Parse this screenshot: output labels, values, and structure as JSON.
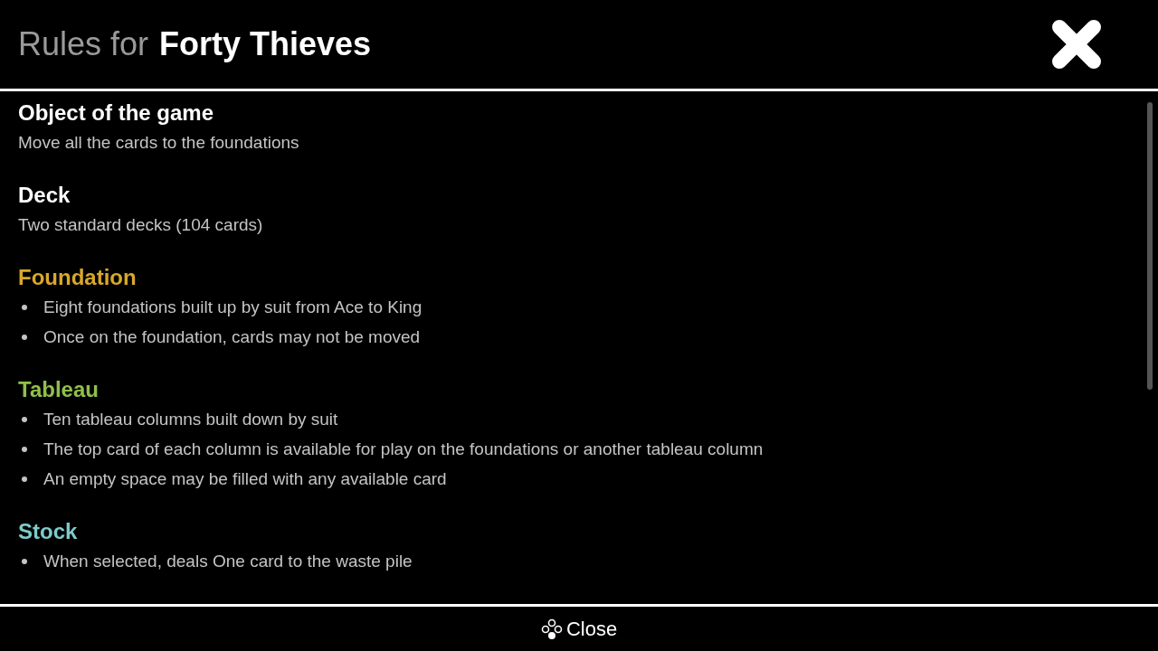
{
  "header": {
    "prefix": "Rules for",
    "game": "Forty Thieves"
  },
  "sections": [
    {
      "heading": "Object of the game",
      "color": "#ffffff",
      "kind": "text",
      "text": "Move all the cards to the foundations"
    },
    {
      "heading": "Deck",
      "color": "#ffffff",
      "kind": "text",
      "text": "Two standard decks (104 cards)"
    },
    {
      "heading": "Foundation",
      "color": "#d9a82a",
      "kind": "list",
      "items": [
        "Eight foundations built up by suit from Ace to King",
        "Once on the foundation, cards may not be moved"
      ]
    },
    {
      "heading": "Tableau",
      "color": "#8fc04a",
      "kind": "list",
      "items": [
        "Ten tableau columns built down by suit",
        "The top card of each column is available for play on the foundations or another tableau column",
        "An empty space may be filled with any available card"
      ]
    },
    {
      "heading": "Stock",
      "color": "#7ecbcb",
      "kind": "list",
      "items": [
        "When selected, deals One card to the waste pile"
      ]
    }
  ],
  "footer": {
    "button": "Close"
  }
}
